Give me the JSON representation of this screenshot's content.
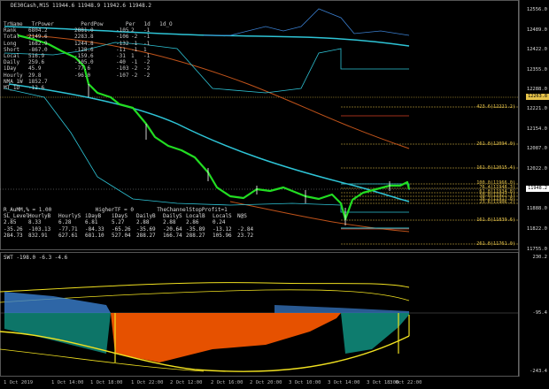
{
  "colors": {
    "background": "#000000",
    "candle_bull": "#22dd22",
    "candle_bear": "#ffffff",
    "ma_cyan": "#2ec4d6",
    "ma_orange": "#c0531a",
    "fib": "#e6c34a",
    "osc_orange": "#ff5a00",
    "osc_blue": "#3a7fd0",
    "osc_yellow": "#f0e020",
    "osc_teal": "#0f8a7a"
  },
  "header": {
    "title": "DE30Cash,M15  11944.6 11948.9 11942.6 11948.2"
  },
  "price_axis": [
    "12556.0",
    "12489.0",
    "12422.0",
    "12355.0",
    "12288.0",
    "12221.0",
    "12154.0",
    "12087.0",
    "12022.0",
    "11955.0",
    "11888.0",
    "11822.0",
    "11755.0"
  ],
  "price_badges": {
    "top": "12263.8",
    "current": "11948.2"
  },
  "fib_levels": [
    {
      "label": "423.6(12221.2)"
    },
    {
      "label": "261.8(12094.0)"
    },
    {
      "label": "161.8(12015.4)"
    },
    {
      "label": "100.0(11966.0)"
    },
    {
      "label": "76.4(11948.3)"
    },
    {
      "label": "61.8(11934.8)"
    },
    {
      "label": "50.0(11927.1)"
    },
    {
      "label": "38.2(11917.8)"
    },
    {
      "label": "23.6(11906.2)"
    },
    {
      "label": "161.8(11839.6)"
    },
    {
      "label": "261.8(11761.0)"
    }
  ],
  "info_table": {
    "headers": [
      "TrName",
      "TrPower",
      "PerdPow",
      "Per",
      "1d",
      "1d_O"
    ],
    "rows": [
      [
        "Rank",
        "6804.2",
        "2881.0",
        "-105",
        "2",
        "-1"
      ],
      [
        "Total",
        "2149.6",
        "2283.8",
        "-106",
        "-2",
        "-1"
      ],
      [
        "Long",
        "1682.9",
        "1244.8",
        "-132",
        "-1",
        "-1"
      ],
      [
        "Short",
        "-867.0",
        "-128.6",
        "-11",
        "-1",
        "1"
      ],
      [
        "Local",
        "516.9",
        "-159.6",
        "-31",
        "1",
        "-1"
      ],
      [
        "Daily",
        "259.6",
        "-105.0",
        "-40",
        "-1",
        "-2"
      ],
      [
        "iDay",
        "45.9",
        "-77.6",
        "-103",
        "-2",
        "-2"
      ],
      [
        "Hourly",
        "29.8",
        "-96.0",
        "-107",
        "-2",
        "-2"
      ],
      [
        "NMA_1W",
        "1852.7",
        "",
        "",
        "",
        ""
      ],
      [
        "MT_1D",
        "-12.6",
        "",
        "",
        "",
        ""
      ]
    ]
  },
  "lower_table": {
    "title_left": "R_AuMM,% = 1.00",
    "title_mid": "HigherTF = 0",
    "title_right": "TheChannelStopProfit=1",
    "headers": [
      "SL_Level:",
      "HourlyB",
      "HourlyS",
      "iDayB",
      "iDayS",
      "DailyB",
      "DailyS",
      "LocalB",
      "LocalS",
      "N@S"
    ],
    "rows": [
      [
        "2.85",
        "8.33",
        "6.28",
        "6.81",
        "5.27",
        "2.88",
        "2.88",
        "2.86",
        "0.24",
        ""
      ],
      [
        "-35.26",
        "-103.13",
        "-77.71",
        "-84.33",
        "-65.26",
        "-35.69",
        "-20.64",
        "-35.89",
        "-13.12",
        "-2.84"
      ],
      [
        "284.73",
        "832.91",
        "627.61",
        "681.10",
        "527.04",
        "288.27",
        "166.74",
        "288.27",
        "105.96",
        "23.72"
      ]
    ]
  },
  "oscillator": {
    "label": "SWT -198.0 -6.3 -4.6",
    "axis": [
      "230.2",
      "-95.4",
      "-243.4"
    ]
  },
  "time_axis": [
    "1 Oct 2019",
    "1 Oct 14:00",
    "1 Oct 18:00",
    "1 Oct 22:00",
    "2 Oct 12:00",
    "2 Oct 16:00",
    "2 Oct 20:00",
    "3 Oct 10:00",
    "3 Oct 14:00",
    "3 Oct 18:00",
    "3 Oct 22:00"
  ]
}
